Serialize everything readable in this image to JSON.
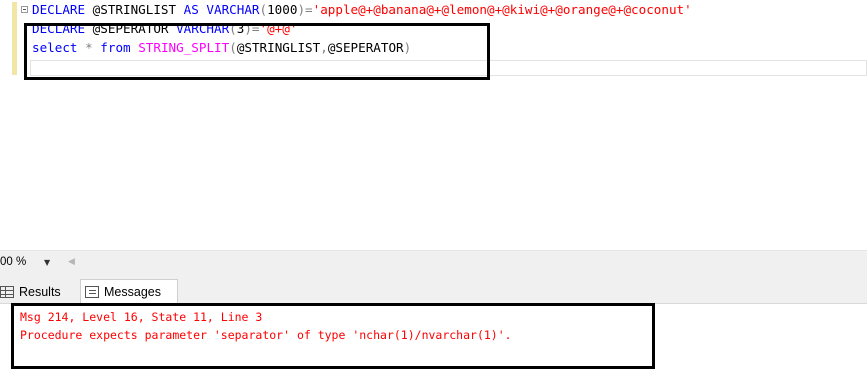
{
  "editor": {
    "lines": [
      {
        "tokens": [
          {
            "text": "DECLARE",
            "kind": "kw"
          },
          {
            "text": " @STRINGLIST ",
            "kind": "id"
          },
          {
            "text": "AS",
            "kind": "kw"
          },
          {
            "text": " ",
            "kind": "id"
          },
          {
            "text": "VARCHAR",
            "kind": "kw"
          },
          {
            "text": "(",
            "kind": "op"
          },
          {
            "text": "1000",
            "kind": "id"
          },
          {
            "text": ")=",
            "kind": "op"
          },
          {
            "text": "'apple@+@banana@+@lemon@+@kiwi@+@orange@+@coconut'",
            "kind": "str"
          }
        ]
      },
      {
        "tokens": [
          {
            "text": "DECLARE",
            "kind": "kw"
          },
          {
            "text": " @SEPERATOR ",
            "kind": "id"
          },
          {
            "text": "VARCHAR",
            "kind": "kw"
          },
          {
            "text": "(",
            "kind": "op"
          },
          {
            "text": "3",
            "kind": "id"
          },
          {
            "text": ")=",
            "kind": "op"
          },
          {
            "text": "'@+@'",
            "kind": "str"
          }
        ]
      },
      {
        "tokens": [
          {
            "text": "select",
            "kind": "kw"
          },
          {
            "text": " ",
            "kind": "id"
          },
          {
            "text": "*",
            "kind": "op"
          },
          {
            "text": " ",
            "kind": "id"
          },
          {
            "text": "from",
            "kind": "kw"
          },
          {
            "text": " ",
            "kind": "id"
          },
          {
            "text": "STRING_SPLIT",
            "kind": "fn"
          },
          {
            "text": "(",
            "kind": "op"
          },
          {
            "text": "@STRINGLIST",
            "kind": "id"
          },
          {
            "text": ",",
            "kind": "op"
          },
          {
            "text": "@SEPERATOR",
            "kind": "id"
          },
          {
            "text": ")",
            "kind": "op"
          }
        ]
      }
    ]
  },
  "zoom": {
    "value": "00 %"
  },
  "tabs": {
    "results": "Results",
    "messages": "Messages"
  },
  "messages": {
    "line1": "Msg 214, Level 16, State 11, Line 3",
    "line2": "Procedure expects parameter 'separator' of type 'nchar(1)/nvarchar(1)'."
  },
  "colors": {
    "keyword": "#0000ff",
    "string": "#ff0000",
    "function": "#ff00ff",
    "operator": "#808080",
    "error": "#ff0000"
  },
  "icons": {
    "collapse": "collapse-minus-icon",
    "zoom_dropdown": "chevron-down-icon",
    "results": "grid-icon",
    "messages": "messages-icon"
  }
}
